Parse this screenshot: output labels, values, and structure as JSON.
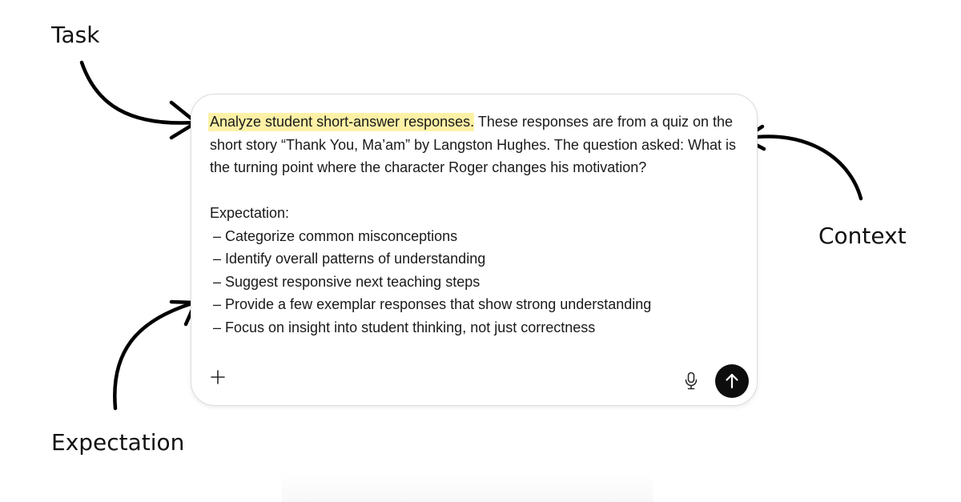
{
  "annotations": {
    "task": "Task",
    "context": "Context",
    "expectation": "Expectation"
  },
  "prompt": {
    "task_highlight": "Analyze student short-answer responses.",
    "context": " These responses are from a quiz on the short story “Thank You, Ma’am” by Langston Hughes. The question asked: What is the turning point where the character Roger changes his motivation?",
    "expectation_heading": "Expectation:",
    "expectation_items": [
      "– Categorize common misconceptions",
      "– Identify overall patterns of understanding",
      "– Suggest responsive next teaching steps",
      "– Provide a few exemplar responses that show strong understanding",
      "– Focus on insight into student thinking, not just correctness"
    ]
  },
  "toolbar": {
    "plus_icon": "plus-icon",
    "mic_icon": "microphone-icon",
    "send_icon": "arrow-up-icon"
  },
  "colors": {
    "highlight": "#fdf1a6",
    "send_button": "#0d0d0d",
    "arrow": "#000000"
  }
}
